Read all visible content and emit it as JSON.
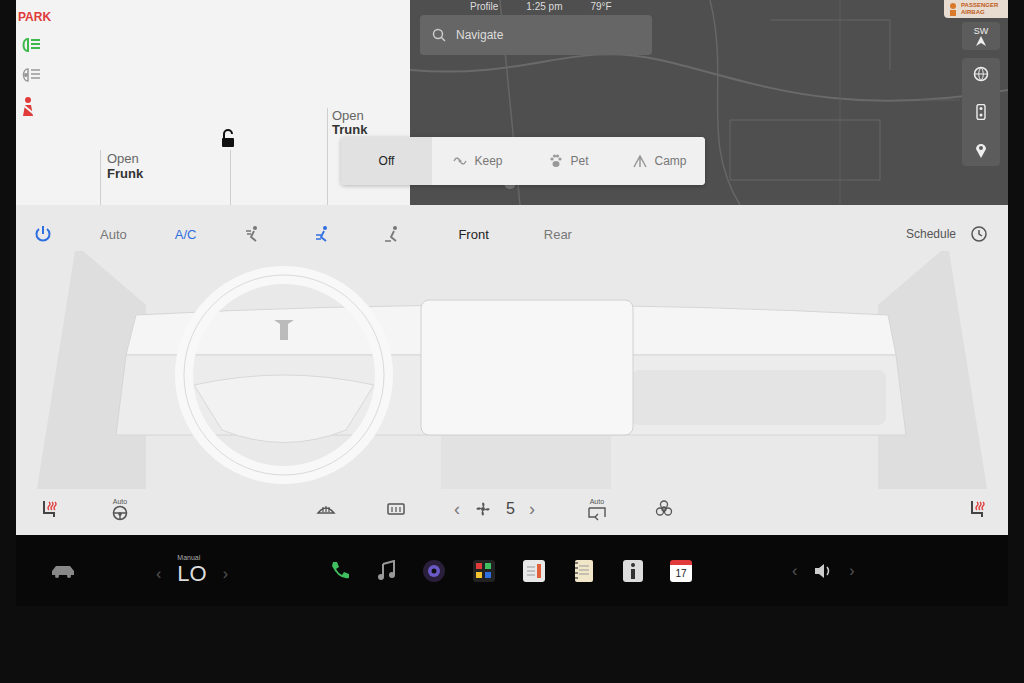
{
  "status_bar": {
    "profile": "Profile",
    "time": "1:25 pm",
    "temp": "79°F"
  },
  "indicators": {
    "park": "PARK"
  },
  "car_panel": {
    "frunk": {
      "action": "Open",
      "name": "Frunk"
    },
    "trunk": {
      "action": "Open",
      "name": "Trunk"
    },
    "locked": false
  },
  "airbag_badge": "PASSENGER AIRBAG",
  "search": {
    "placeholder": "Navigate"
  },
  "compass": "SW",
  "climate_modes": [
    {
      "label": "Off",
      "selected": true
    },
    {
      "label": "Keep",
      "selected": false
    },
    {
      "label": "Pet",
      "selected": false
    },
    {
      "label": "Camp",
      "selected": false
    }
  ],
  "climate": {
    "power_on": true,
    "auto": {
      "label": "Auto",
      "on": false
    },
    "ac": {
      "label": "A/C",
      "on": true
    },
    "airflow": [
      {
        "selected": false
      },
      {
        "selected": true
      },
      {
        "selected": false
      }
    ],
    "zones": [
      {
        "label": "Front",
        "selected": true
      },
      {
        "label": "Rear",
        "selected": false
      }
    ],
    "schedule": "Schedule",
    "seat_heat_left": {
      "on": true
    },
    "steering_heat": {
      "label": "Auto"
    },
    "fan": {
      "left": "‹",
      "speed": "5",
      "right": "›"
    },
    "recirc": {
      "label": "Auto"
    },
    "seat_heat_right": {
      "on": true
    }
  },
  "dock": {
    "temp_mode": "Manual",
    "temp_left": "‹",
    "temp": "LO",
    "temp_right": "›",
    "calendar_day": "17",
    "vol_left": "‹",
    "vol_right": "›"
  }
}
